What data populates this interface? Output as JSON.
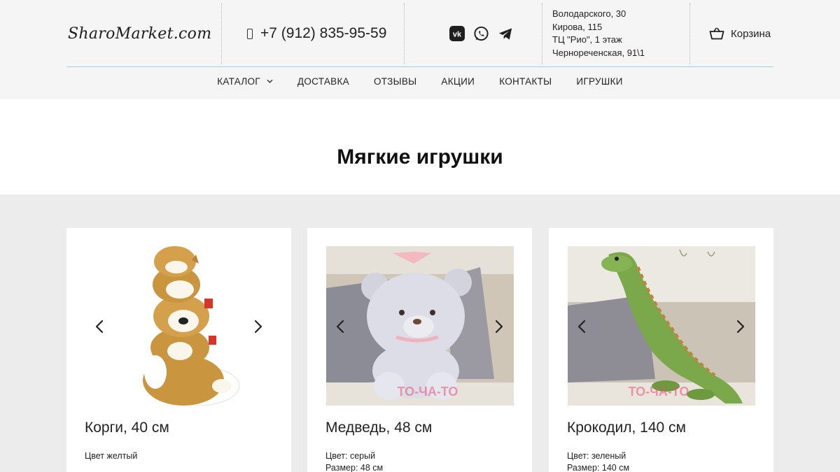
{
  "header": {
    "logo": "SharoMarket.com",
    "phone": "+7 (912) 835-95-59",
    "socials": [
      "vk-icon",
      "whatsapp-icon",
      "telegram-icon"
    ],
    "address_lines": [
      "Володарского, 30",
      "Кирова, 115",
      "ТЦ \"Рио\", 1 этаж",
      "Чернореченская, 91\\1"
    ],
    "cart_label": "Корзина"
  },
  "nav": {
    "items": [
      "КАТАЛОГ",
      "ДОСТАВКА",
      "ОТЗЫВЫ",
      "АКЦИИ",
      "КОНТАКТЫ",
      "ИГРУШКИ"
    ]
  },
  "page_title": "Мягкие игрушки",
  "products": [
    {
      "name": "Корги, 40 см",
      "desc_lines": [
        "Цвет желтый"
      ]
    },
    {
      "name": "Медведь, 48 см",
      "desc_lines": [
        "Цвет: серый",
        "Размер: 48 см"
      ]
    },
    {
      "name": "Крокодил, 140 см",
      "desc_lines": [
        "Цвет: зеленый",
        "Размер: 140 см"
      ]
    }
  ],
  "colors": {
    "header_bg": "#f5f5f5",
    "section_bg": "#ececec",
    "divider_blue": "#9fd0e8",
    "watermark_pink": "#e0557a"
  }
}
